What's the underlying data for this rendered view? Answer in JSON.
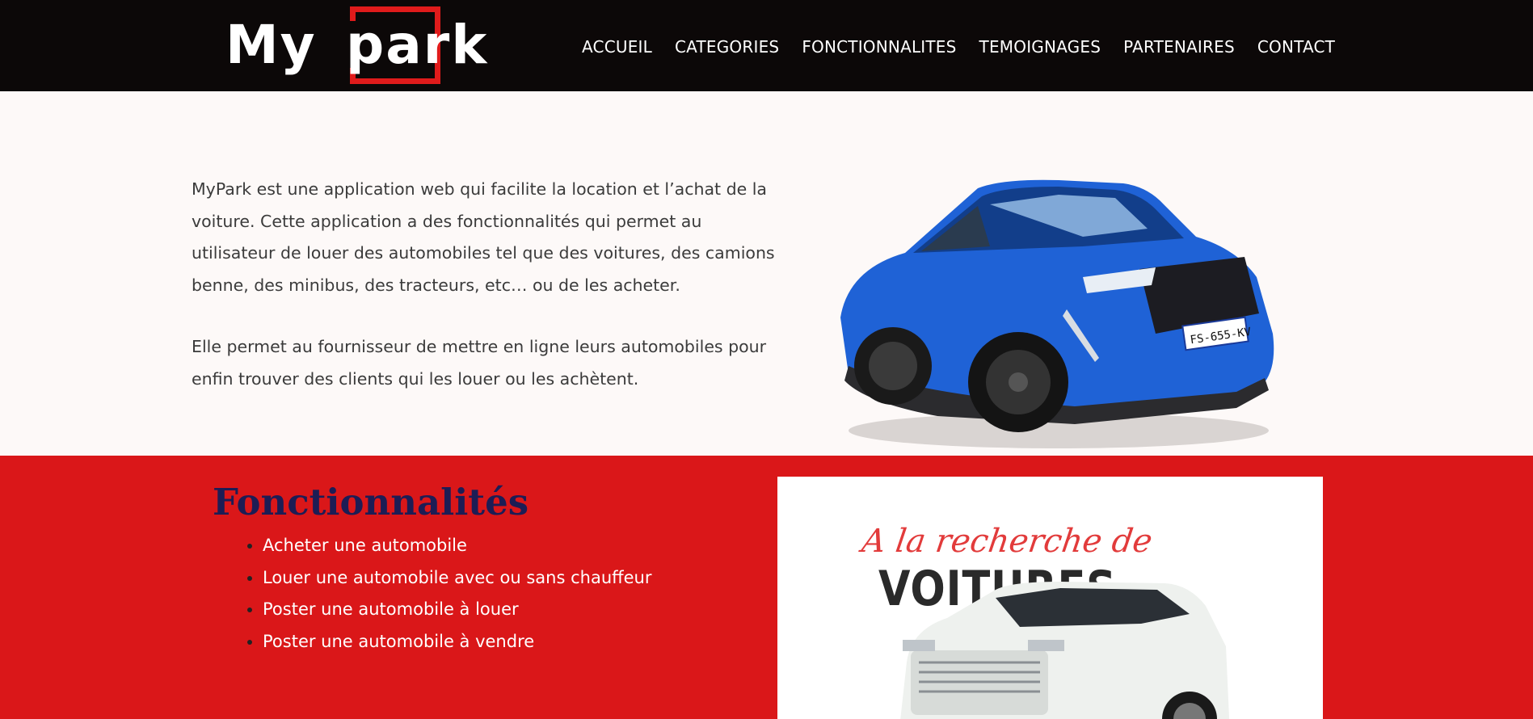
{
  "header": {
    "logo_my": "My",
    "logo_park": "park",
    "nav": [
      "ACCUEIL",
      "CATEGORIES",
      "FONCTIONNALITES",
      "TEMOIGNAGES",
      "PARTENAIRES",
      "CONTACT"
    ]
  },
  "intro": {
    "paragraph1": "MyPark est une application web qui facilite la location et l’achat de la voiture. Cette application a des fonctionnalités qui permet au utilisateur de louer des automobiles tel que des voitures, des camions benne, des minibus, des tracteurs, etc… ou de les acheter.",
    "paragraph2": "Elle permet au fournisseur de mettre en ligne leurs automobiles pour enfin trouver des clients qui les louer ou les achètent.",
    "car_plate": "FS-655-KV"
  },
  "features": {
    "title": "Fonctionnalités",
    "items": [
      "Acheter une automobile",
      "Louer une automobile avec ou sans chauffeur",
      "Poster une automobile à louer",
      "Poster une automobile à vendre"
    ]
  },
  "promo": {
    "script": "A la recherche de",
    "big": "VOITURES"
  },
  "colors": {
    "header_bg": "#0c0808",
    "accent_red": "#da1719",
    "title_navy": "#1d1d55",
    "car_blue": "#1f62d6"
  }
}
